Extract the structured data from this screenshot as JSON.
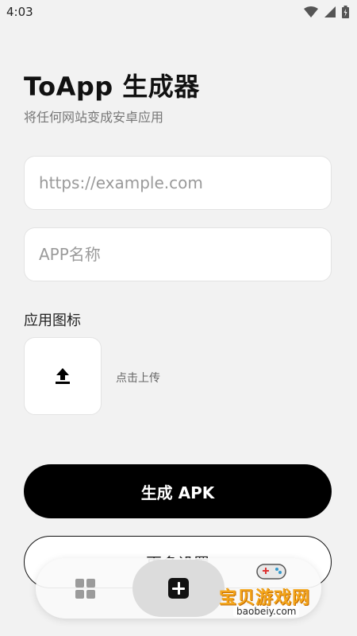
{
  "status_bar": {
    "time": "4:03",
    "icons": [
      "wifi-icon",
      "signal-icon",
      "battery-icon"
    ]
  },
  "header": {
    "title": "ToApp 生成器",
    "subtitle": "将任何网站变成安卓应用"
  },
  "form": {
    "url_placeholder": "https://example.com",
    "url_value": "",
    "name_placeholder": "APP名称",
    "name_value": "",
    "icon_label": "应用图标",
    "upload_hint": "点击上传",
    "upload_icon": "upload-icon"
  },
  "actions": {
    "generate_label": "生成 APK",
    "more_settings_label": "更多设置"
  },
  "bottom_nav": {
    "items": [
      {
        "icon": "grid-icon",
        "active": false
      },
      {
        "icon": "add-icon",
        "active": true
      }
    ]
  },
  "watermark": {
    "brand_text": "宝贝游戏网",
    "url_text": "baobeiy.com"
  },
  "colors": {
    "background": "#f2f2f2",
    "primary": "#000000",
    "accent": "#f3a51a"
  }
}
